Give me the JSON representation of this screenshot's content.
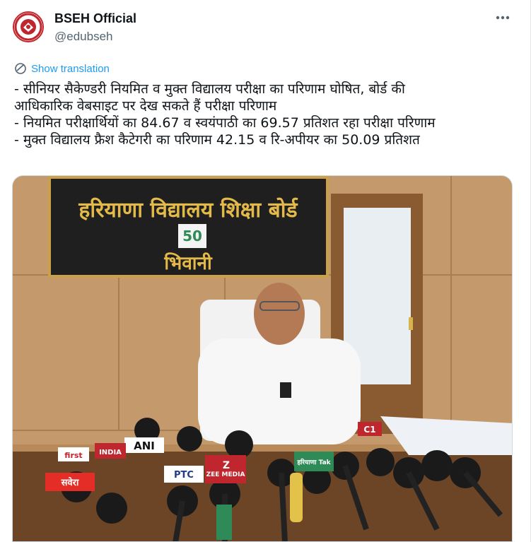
{
  "account": {
    "display_name": "BSEH Official",
    "handle": "@edubseh"
  },
  "translation": {
    "label": "Show translation"
  },
  "tweet": {
    "lines": [
      "- सीनियर सैकेण्डरी नियमित व मुक्त विद्यालय परीक्षा का परिणाम घोषित, बोर्ड की",
      "आधिकारिक वेबसाइट पर देख सकते हैं परीक्षा परिणाम",
      "- नियमित परीक्षार्थियों का 84.67 व स्वयंपाठी का 69.57 प्रतिशत रहा परीक्षा परिणाम",
      "- मुक्त विद्यालय फ्रैश कैटेगरी का परिणाम 42.15 व रि-अपीयर का 50.09 प्रतिशत"
    ]
  },
  "photo": {
    "sign_line1": "हरियाणा विद्यालय शिक्षा बोर्ड",
    "sign_line2": "भिवानी",
    "logo_number": "50",
    "mic_labels": [
      "ANI",
      "first",
      "INDIA",
      "सवेरा",
      "PTC",
      "ZEE MEDIA",
      "हरियाणा Tak",
      "C1",
      "Z"
    ]
  },
  "colors": {
    "link": "#1d9bf0",
    "text": "#0f1419",
    "muted": "#536471",
    "sign_bg": "#1f1f1f",
    "sign_text": "#e3b94a",
    "wood": "#c49a6c"
  },
  "icons": {
    "more": "more-horizontal-icon",
    "translate": "globe-translate-icon",
    "avatar": "bseh-logo-icon"
  }
}
